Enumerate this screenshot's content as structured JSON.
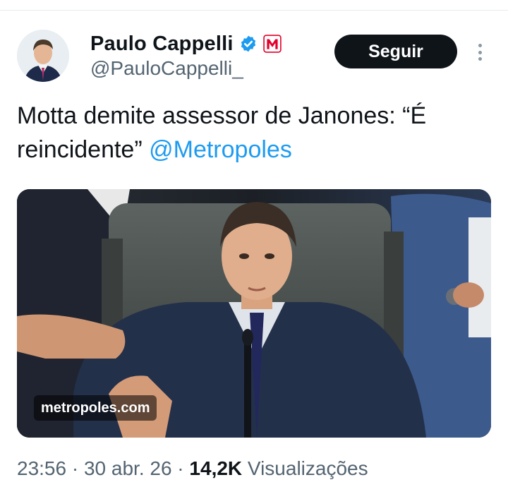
{
  "author": {
    "display_name": "Paulo Cappelli",
    "handle": "@PauloCappelli_",
    "verified_icon": "verified-badge-icon",
    "affiliate_badge": "metropoles-m-icon",
    "avatar": "profile-photo"
  },
  "follow_button": {
    "label": "Seguir"
  },
  "more_menu": {
    "icon": "vertical-ellipsis-icon"
  },
  "tweet": {
    "text_before_mention": "Motta demite assessor de Janones: “É reincidente” ",
    "mention": "@Metropoles"
  },
  "media": {
    "source_label": "metropoles.com",
    "description_icon": "news-photo"
  },
  "meta": {
    "time": "23:56",
    "separator": " · ",
    "date": "30 abr. 26",
    "views_count": "14,2K",
    "views_label": " Visualizações"
  },
  "colors": {
    "text_primary": "#0f1419",
    "text_secondary": "#536471",
    "link": "#1d9bf0",
    "verified": "#1d9bf0",
    "affiliate_red": "#e3002b",
    "follow_bg": "#0f1419"
  }
}
